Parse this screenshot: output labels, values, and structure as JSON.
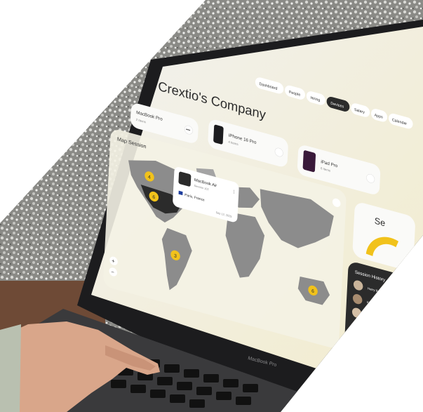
{
  "header": {
    "company_title": "Crextio's Company",
    "nav": [
      "Dashboard",
      "People",
      "Hiring",
      "Devices",
      "Salary",
      "Apps",
      "Calendar"
    ],
    "active_nav": "Devices"
  },
  "devices": [
    {
      "name": "MacBook Pro",
      "count": "2 Items"
    },
    {
      "name": "iPhone 16 Pro",
      "count": "4 Items"
    },
    {
      "name": "iPad Pro",
      "count": "6 Items"
    }
  ],
  "map": {
    "title": "Map Session",
    "popup": {
      "device": "MacBook Air",
      "user": "Session 102",
      "location": "Paris, France",
      "date": "Sep 12, 2025"
    },
    "markers": [
      {
        "label": "4",
        "region": "north-america-north"
      },
      {
        "label": "6",
        "region": "north-america-south"
      },
      {
        "label": "3",
        "region": "south-america"
      },
      {
        "label": "6",
        "region": "australia"
      }
    ],
    "zoom_in": "+",
    "zoom_out": "−"
  },
  "side_panel": {
    "partial_title": "Se",
    "session_history_title": "Session History",
    "sessions": [
      "Harry Ba",
      "Kory Tuler",
      "Jonathan Ke",
      "Billie Wi",
      "Ella Wi"
    ]
  },
  "laptop_brand": "MacBook Pro",
  "colors": {
    "accent": "#f1c21b",
    "dark": "#2b2b2b",
    "map_land": "#8c8c8c",
    "map_bg": "#ecead8"
  }
}
